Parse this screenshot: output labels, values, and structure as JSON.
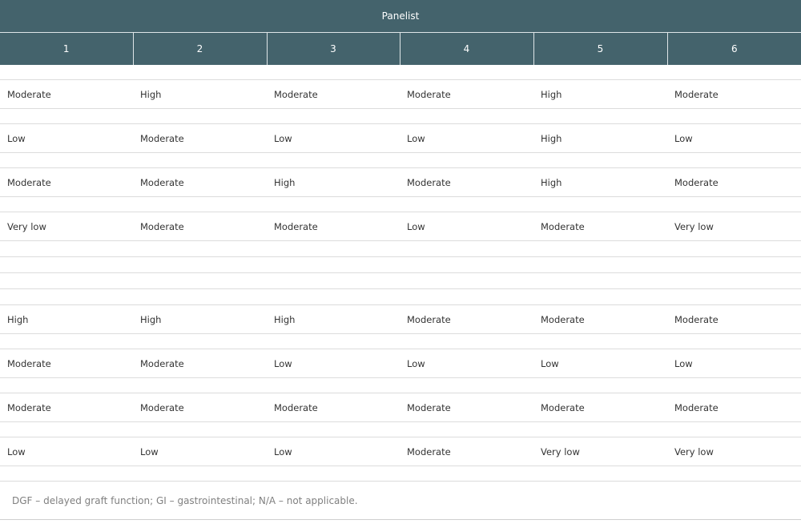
{
  "table": {
    "group_header": "Panelist",
    "columns": [
      "1",
      "2",
      "3",
      "4",
      "5",
      "6"
    ],
    "block1": [
      [
        "Moderate",
        "High",
        "Moderate",
        "Moderate",
        "High",
        "Moderate"
      ],
      [
        "Low",
        "Moderate",
        "Low",
        "Low",
        "High",
        "Low"
      ],
      [
        "Moderate",
        "Moderate",
        "High",
        "Moderate",
        "High",
        "Moderate"
      ],
      [
        "Very low",
        "Moderate",
        "Moderate",
        "Low",
        "Moderate",
        "Very low"
      ]
    ],
    "block2": [
      [
        "High",
        "High",
        "High",
        "Moderate",
        "Moderate",
        "Moderate"
      ],
      [
        "Moderate",
        "Moderate",
        "Low",
        "Low",
        "Low",
        "Low"
      ],
      [
        "Moderate",
        "Moderate",
        "Moderate",
        "Moderate",
        "Moderate",
        "Moderate"
      ],
      [
        "Low",
        "Low",
        "Low",
        "Moderate",
        "Very low",
        "Very low"
      ]
    ]
  },
  "footnote": "DGF – delayed graft function; GI – gastrointestinal; N/A – not applicable."
}
